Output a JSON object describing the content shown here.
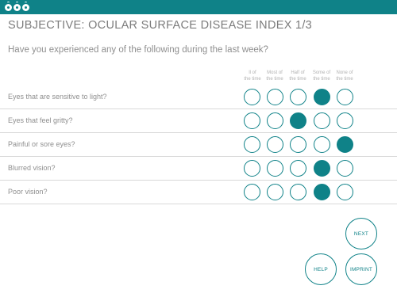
{
  "header": {
    "logo_icon": "eyes-logo-icon",
    "brand_color": "#0f8288"
  },
  "page_title": "SUBJECTIVE: OCULAR SURFACE DISEASE INDEX 1/3",
  "question": "Have you experienced any of the following during the last week?",
  "columns": [
    {
      "line1": "ll of",
      "line2": "the time"
    },
    {
      "line1": "Most of",
      "line2": "the time"
    },
    {
      "line1": "Half of",
      "line2": "the time"
    },
    {
      "line1": "Some of",
      "line2": "the time"
    },
    {
      "line1": "None of",
      "line2": "the time"
    }
  ],
  "rows": [
    {
      "label": "Eyes that are sensitive to light?",
      "selected_index": 3
    },
    {
      "label": "Eyes that feel gritty?",
      "selected_index": 2
    },
    {
      "label": "Painful or sore eyes?",
      "selected_index": 4
    },
    {
      "label": "Blurred vision?",
      "selected_index": 3
    },
    {
      "label": "Poor vision?",
      "selected_index": 3
    }
  ],
  "buttons": {
    "next": "NEXT",
    "help": "HELP",
    "imprint": "IMPRINT"
  }
}
